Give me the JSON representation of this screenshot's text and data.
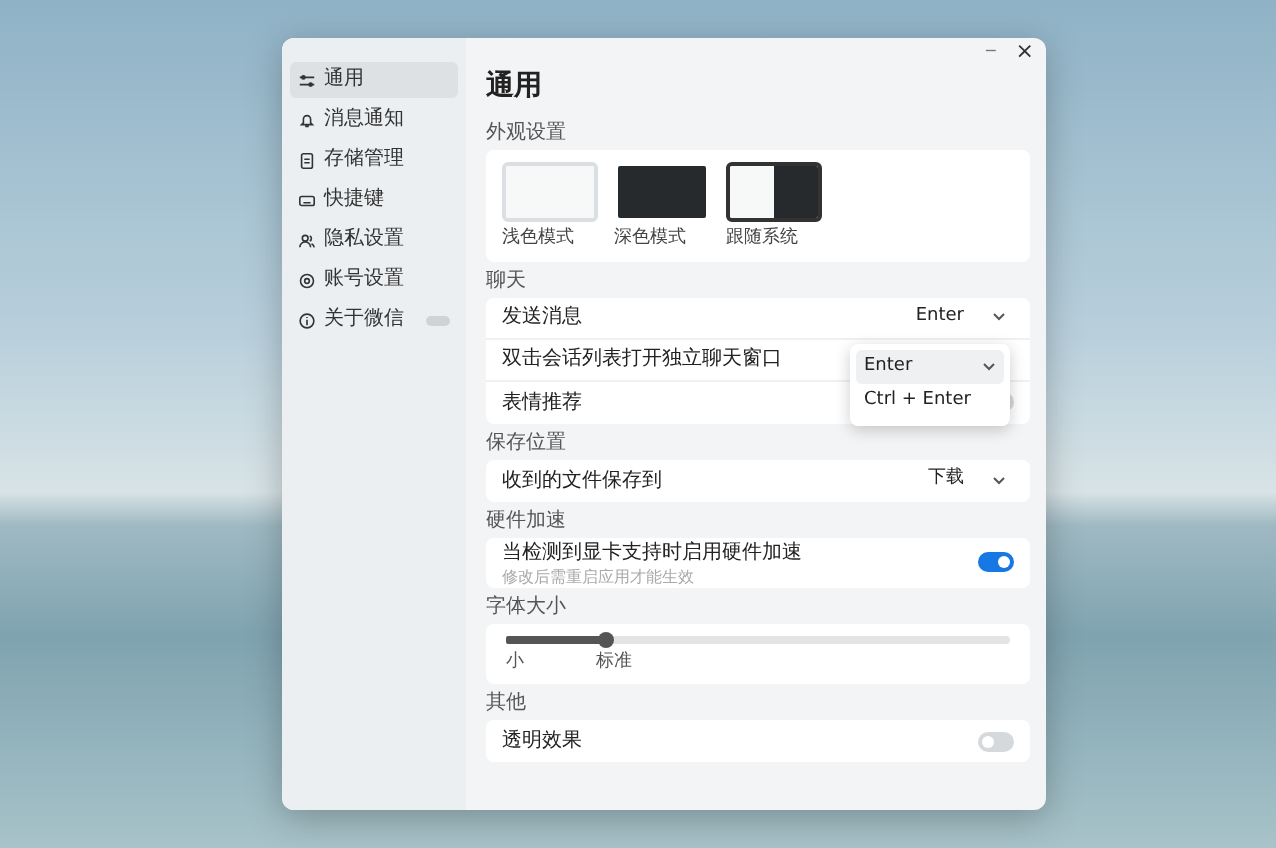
{
  "title_bar": {
    "buttons": [
      {
        "kind": "minimize",
        "label": "─"
      },
      {
        "kind": "close",
        "label": "×"
      }
    ]
  },
  "sidebar": {
    "items": [
      {
        "label": "通用",
        "selected": true,
        "badge": false
      },
      {
        "label": "消息通知",
        "selected": false,
        "badge": false
      },
      {
        "label": "存储管理",
        "selected": false,
        "badge": false
      },
      {
        "label": "快捷键",
        "selected": false,
        "badge": false
      },
      {
        "label": "隐私设置",
        "selected": false,
        "badge": false
      },
      {
        "label": "账号设置",
        "selected": false,
        "badge": false
      },
      {
        "label": "关于微信",
        "selected": false,
        "badge": true
      }
    ]
  },
  "page_title": "通用",
  "sections": [
    {
      "title": "外观设置",
      "kind": "themes",
      "themes": [
        {
          "label": "浅色模式",
          "kind": "light",
          "selected": false
        },
        {
          "label": "深色模式",
          "kind": "dark",
          "selected": false
        },
        {
          "label": "跟随系统",
          "kind": "system",
          "selected": true
        }
      ]
    },
    {
      "title": "聊天",
      "kind": "rows",
      "rows": [
        {
          "kind": "select",
          "label": "发送消息",
          "value": "Enter",
          "menu": {
            "options": [
              {
                "label": "Enter",
                "selected": true
              },
              {
                "label": "Ctrl + Enter",
                "selected": false
              }
            ]
          }
        },
        {
          "kind": "plain",
          "label": "双击会话列表打开独立聊天窗口"
        },
        {
          "kind": "toggle",
          "label": "表情推荐",
          "on": false
        }
      ]
    },
    {
      "title": "保存位置",
      "kind": "rows",
      "rows": [
        {
          "kind": "select",
          "label": "收到的文件保存到",
          "value": "下载"
        }
      ]
    },
    {
      "title": "硬件加速",
      "kind": "rows",
      "rows": [
        {
          "kind": "toggle",
          "label": "当检测到显卡支持时启用硬件加速",
          "note": "修改后需重启应用才能生效",
          "on": true
        }
      ]
    },
    {
      "title": "字体大小",
      "kind": "slider",
      "level": 0.2,
      "ticks": [
        "小",
        "标准"
      ]
    },
    {
      "title": "其他",
      "kind": "rows",
      "rows": [
        {
          "kind": "toggle",
          "label": "透明效果",
          "on": false
        }
      ]
    }
  ]
}
